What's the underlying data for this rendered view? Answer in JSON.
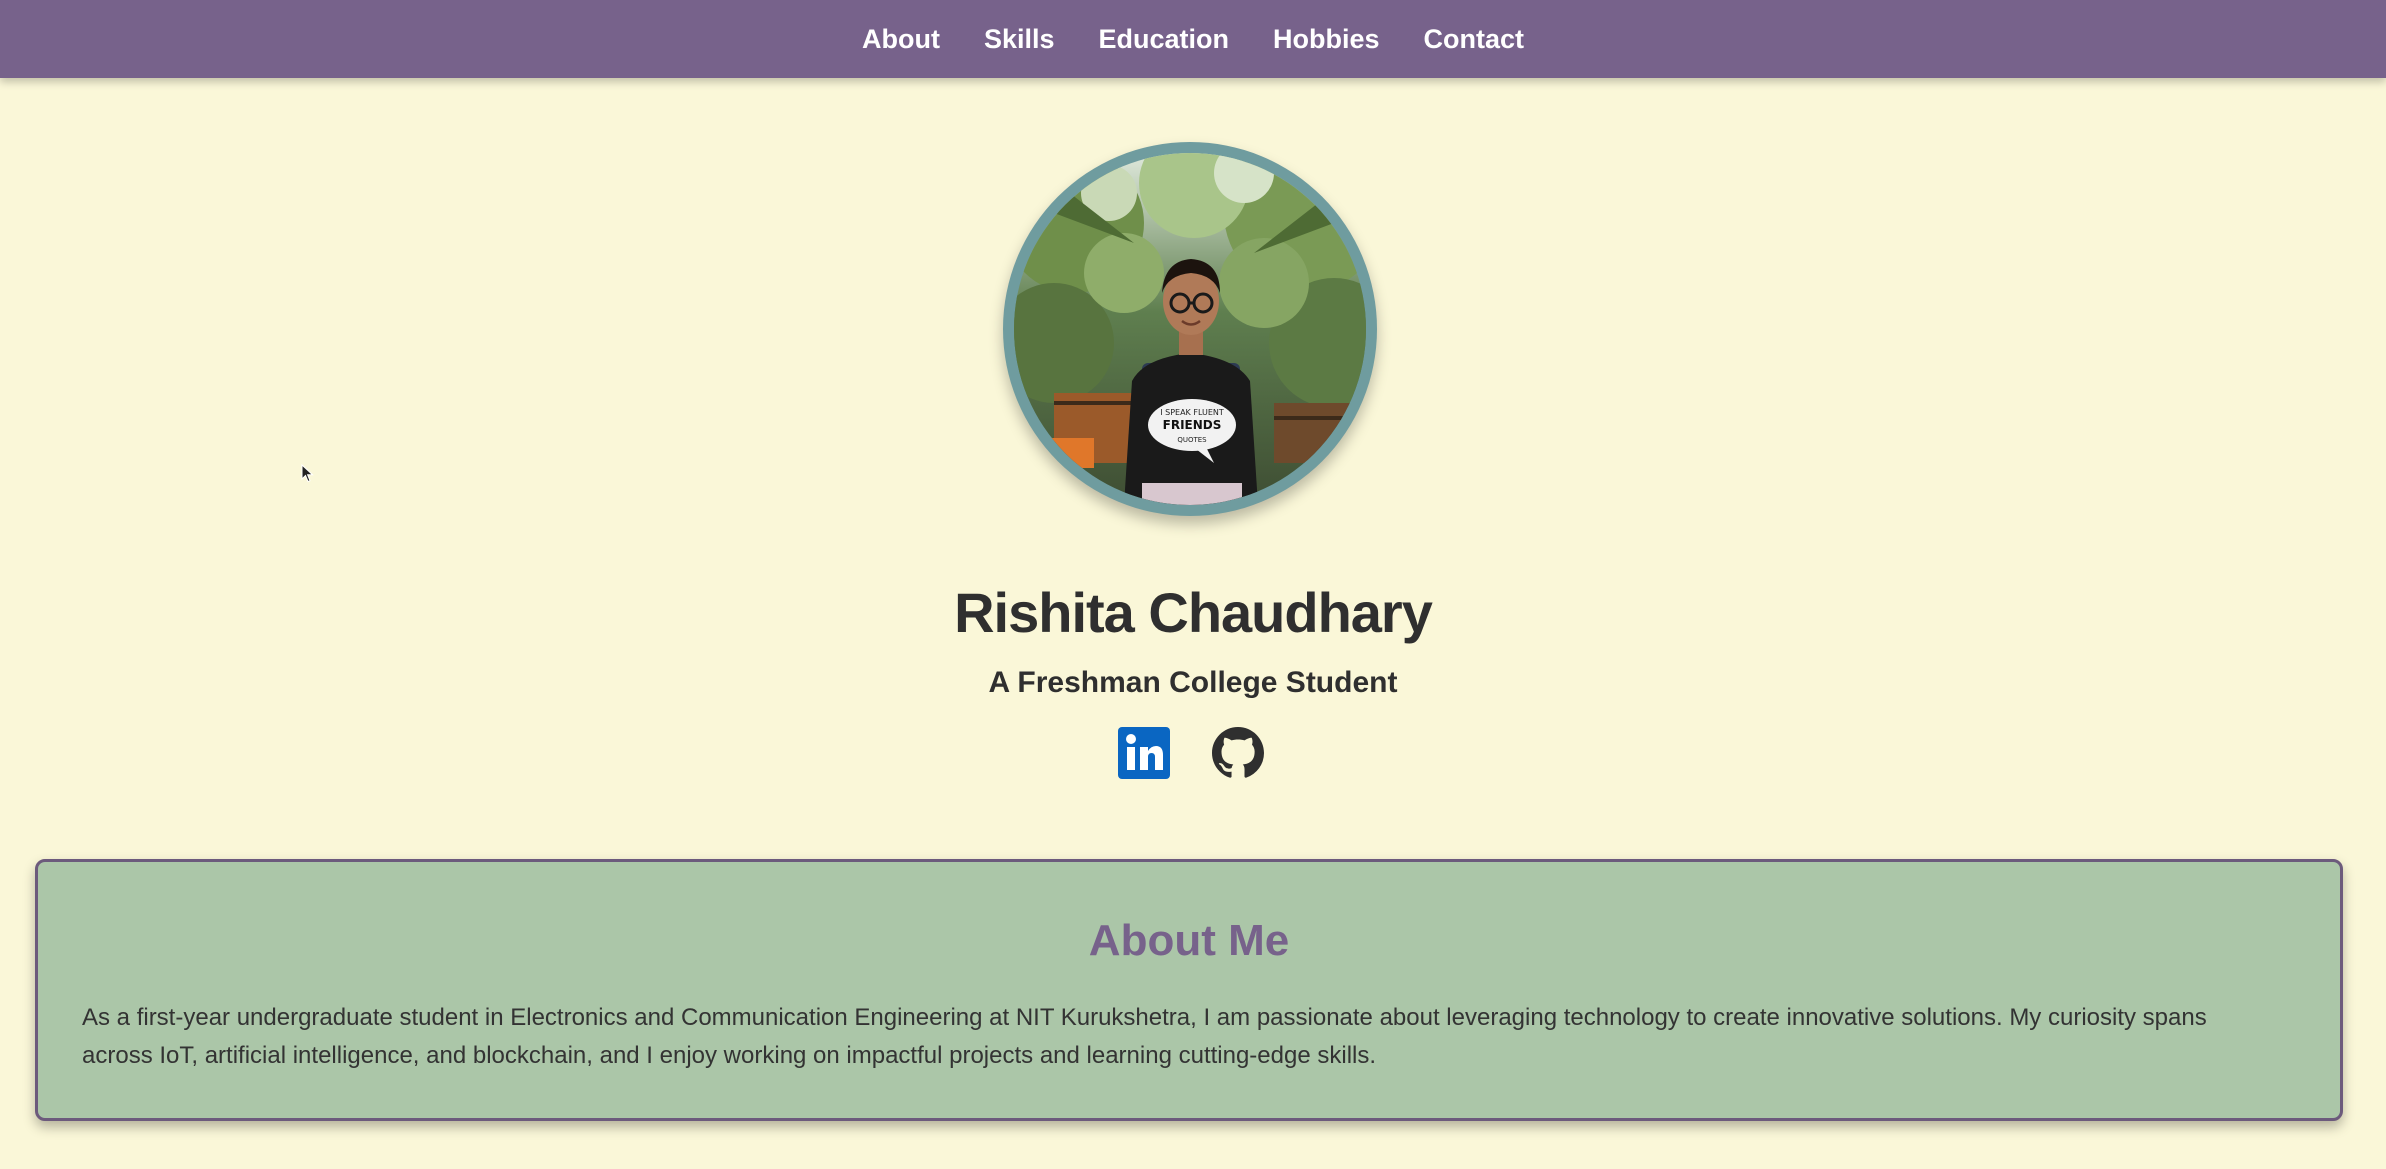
{
  "nav": {
    "items": [
      {
        "label": "About"
      },
      {
        "label": "Skills"
      },
      {
        "label": "Education"
      },
      {
        "label": "Hobbies"
      },
      {
        "label": "Contact"
      }
    ]
  },
  "profile": {
    "name": "Rishita Chaudhary",
    "tagline": "A Freshman College Student",
    "photo_alt": "Profile photo",
    "tshirt_text": [
      "I SPEAK FLUENT",
      "FRIENDS",
      "QUOTES"
    ]
  },
  "social": {
    "linkedin_icon": "linkedin-icon",
    "github_icon": "github-icon"
  },
  "about": {
    "title": "About Me",
    "text": "As a first-year undergraduate student in Electronics and Communication Engineering at NIT Kurukshetra, I am passionate about leveraging technology to create innovative solutions. My curiosity spans across IoT, artificial intelligence, and blockchain, and I enjoy working on impactful projects and learning cutting-edge skills."
  },
  "colors": {
    "nav_bg": "#77628b",
    "page_bg": "#faf7d8",
    "card_bg": "#abc6a8",
    "accent": "#77628b",
    "avatar_ring": "#6f9c9f",
    "linkedin": "#0a66c2"
  }
}
